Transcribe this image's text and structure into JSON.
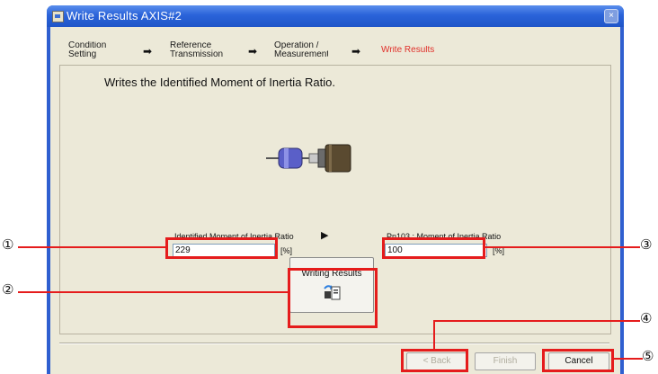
{
  "window": {
    "title": "Write Results AXIS#2",
    "close_glyph": "×"
  },
  "steps": [
    {
      "label": "Condition Setting",
      "active": false
    },
    {
      "label": "Reference Transmission",
      "active": false
    },
    {
      "label": "Operation / Measurement",
      "active": false
    },
    {
      "label": "Write Results",
      "active": true
    }
  ],
  "step_arrow": "➡",
  "heading": "Writes the Identified Moment of Inertia Ratio.",
  "identified": {
    "label": "Identified Moment of Inertia Ratio",
    "value": "229",
    "unit": "[%]"
  },
  "transfer_glyph": "▶",
  "parameter": {
    "label": "Pn103 : Moment of Inertia Ratio",
    "value": "100",
    "unit": "[%]"
  },
  "write_button": {
    "label": "Writing Results"
  },
  "footer": {
    "back": "< Back",
    "finish": "Finish",
    "cancel": "Cancel"
  },
  "callouts": [
    "①",
    "②",
    "③",
    "④",
    "⑤"
  ],
  "colors": {
    "highlight": "#e51c1c",
    "active_step": "#e0302a",
    "titlebar": "#2a63d9"
  }
}
